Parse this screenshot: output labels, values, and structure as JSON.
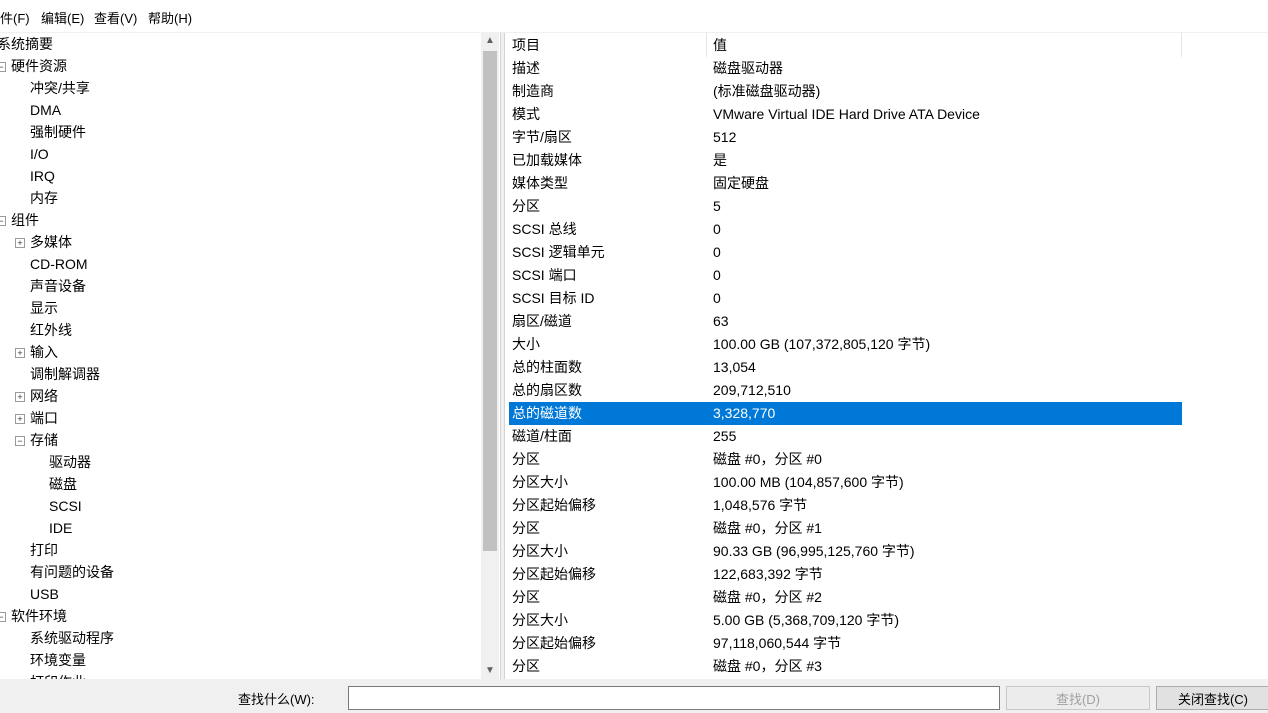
{
  "menubar": {
    "items": [
      "件(F)",
      "编辑(E)",
      "查看(V)",
      "帮助(H)"
    ]
  },
  "tree": {
    "items": [
      {
        "label": "系统摘要",
        "expander": ""
      },
      {
        "label": "硬件资源",
        "expander": "−"
      },
      {
        "label": "冲突/共享",
        "expander": ""
      },
      {
        "label": "DMA",
        "expander": ""
      },
      {
        "label": "强制硬件",
        "expander": ""
      },
      {
        "label": "I/O",
        "expander": ""
      },
      {
        "label": "IRQ",
        "expander": ""
      },
      {
        "label": "内存",
        "expander": ""
      },
      {
        "label": "组件",
        "expander": "−"
      },
      {
        "label": "多媒体",
        "expander": "+"
      },
      {
        "label": "CD-ROM",
        "expander": ""
      },
      {
        "label": "声音设备",
        "expander": ""
      },
      {
        "label": "显示",
        "expander": ""
      },
      {
        "label": "红外线",
        "expander": ""
      },
      {
        "label": "输入",
        "expander": "+"
      },
      {
        "label": "调制解调器",
        "expander": ""
      },
      {
        "label": "网络",
        "expander": "+"
      },
      {
        "label": "端口",
        "expander": "+"
      },
      {
        "label": "存储",
        "expander": "−"
      },
      {
        "label": "驱动器",
        "expander": ""
      },
      {
        "label": "磁盘",
        "expander": ""
      },
      {
        "label": "SCSI",
        "expander": ""
      },
      {
        "label": "IDE",
        "expander": ""
      },
      {
        "label": "打印",
        "expander": ""
      },
      {
        "label": "有问题的设备",
        "expander": ""
      },
      {
        "label": "USB",
        "expander": ""
      },
      {
        "label": "软件环境",
        "expander": "−"
      },
      {
        "label": "系统驱动程序",
        "expander": ""
      },
      {
        "label": "环境变量",
        "expander": ""
      },
      {
        "label": "打印作业",
        "expander": ""
      }
    ]
  },
  "table": {
    "headers": [
      "项目",
      "值"
    ],
    "selected_index": 16,
    "rows": [
      [
        "描述",
        "磁盘驱动器"
      ],
      [
        "制造商",
        "(标准磁盘驱动器)"
      ],
      [
        "模式",
        "VMware Virtual IDE Hard Drive ATA Device"
      ],
      [
        "字节/扇区",
        "512"
      ],
      [
        "已加载媒体",
        "是"
      ],
      [
        "媒体类型",
        "固定硬盘"
      ],
      [
        "分区",
        "5"
      ],
      [
        "SCSI 总线",
        "0"
      ],
      [
        "SCSI 逻辑单元",
        "0"
      ],
      [
        "SCSI 端口",
        "0"
      ],
      [
        "SCSI 目标 ID",
        "0"
      ],
      [
        "扇区/磁道",
        "63"
      ],
      [
        "大小",
        "100.00 GB (107,372,805,120 字节)"
      ],
      [
        "总的柱面数",
        "13,054"
      ],
      [
        "总的扇区数",
        "209,712,510"
      ],
      [
        "总的磁道数",
        "3,328,770"
      ],
      [
        "磁道/柱面",
        "255"
      ],
      [
        "分区",
        "磁盘 #0，分区 #0"
      ],
      [
        "分区大小",
        "100.00 MB (104,857,600 字节)"
      ],
      [
        "分区起始偏移",
        "1,048,576 字节"
      ],
      [
        "分区",
        "磁盘 #0，分区 #1"
      ],
      [
        "分区大小",
        "90.33 GB (96,995,125,760 字节)"
      ],
      [
        "分区起始偏移",
        "122,683,392 字节"
      ],
      [
        "分区",
        "磁盘 #0，分区 #2"
      ],
      [
        "分区大小",
        "5.00 GB (5,368,709,120 字节)"
      ],
      [
        "分区起始偏移",
        "97,118,060,544 字节"
      ],
      [
        "分区",
        "磁盘 #0，分区 #3"
      ]
    ]
  },
  "find_bar": {
    "label": "查找什么(W):",
    "find_button": "查找(D)",
    "close_find_button": "关闭查找(C)",
    "input_value": ""
  },
  "colors": {
    "selection": "#0078d7"
  },
  "icons": {
    "scroll_up": "▲",
    "scroll_down": "▼"
  }
}
